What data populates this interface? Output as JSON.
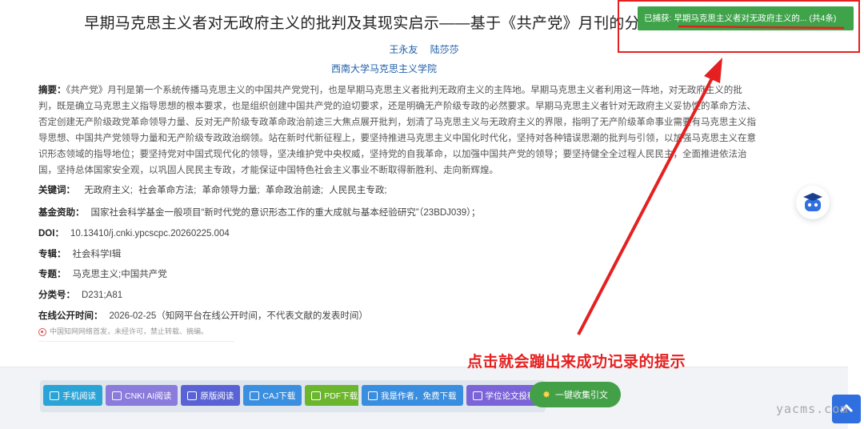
{
  "article": {
    "title": "早期马克思主义者对无政府主义的批判及其现实启示——基于《共产党》月刊的分",
    "authors": [
      "王永友",
      "陆莎莎"
    ],
    "institution": "西南大学马克思主义学院",
    "abstract_label": "摘要：",
    "abstract": "《共产党》月刊是第一个系统传播马克思主义的中国共产党党刊，也是早期马克思主义者批判无政府主义的主阵地。早期马克思主义者利用这一阵地，对无政府主义的批判，既是确立马克思主义指导思想的根本要求，也是组织创建中国共产党的迫切要求，还是明确无产阶级专政的必然要求。早期马克思主义者针对无政府主义妥协性的革命方法、否定创建无产阶级政党革命领导力量、反对无产阶级专政革命政治前途三大焦点展开批判，划清了马克思主义与无政府主义的界限，指明了无产阶级革命事业需要有马克思主义指导思想、中国共产党领导力量和无产阶级专政政治纲领。站在新时代新征程上，要坚持推进马克思主义中国化时代化，坚持对各种错误思潮的批判与引领，以加强马克思主义在意识形态领域的指导地位；要坚持党对中国式现代化的领导，坚决维护党中央权威，坚持党的自我革命，以加强中国共产党的领导；要坚持健全全过程人民民主，全面推进依法治国，坚持总体国家安全观，以巩固人民民主专政，才能保证中国特色社会主义事业不断取得新胜利、走向新辉煌。",
    "keywords_label": "关键词：",
    "keywords": [
      "无政府主义;",
      "社会革命方法;",
      "革命领导力量;",
      "革命政治前途;",
      "人民民主专政;"
    ],
    "fund_label": "基金资助：",
    "fund": "国家社会科学基金一般项目“新时代党的意识形态工作的重大成就与基本经验研究”（23BDJ039）；",
    "doi_label": "DOI：",
    "doi": "10.13410/j.cnki.ypcscpc.20260225.004",
    "series_label": "专辑：",
    "series": "社会科学Ⅰ辑",
    "topic_label": "专题：",
    "topic": "马克思主义;中国共产党",
    "class_label": "分类号：",
    "class": "D231;A81",
    "online_label": "在线公开时间：",
    "online": "2026-02-25（知网平台在线公开时间，不代表文献的发表时间）",
    "notice": "中国知网网络首发，未经许可，禁止转载、摘编。"
  },
  "toolbar": {
    "group1": [
      {
        "label": "手机阅读",
        "icon": "phone-icon",
        "color": "#2aa4d6"
      },
      {
        "label": "CNKI AI阅读",
        "icon": "ai-icon",
        "color": "#8a7bdc"
      },
      {
        "label": "原版阅读",
        "icon": "book-icon",
        "color": "#5a63d6"
      },
      {
        "label": "CAJ下载",
        "icon": "open-book-icon",
        "color": "#3b8fe0"
      },
      {
        "label": "PDF下载",
        "icon": "pdf-icon",
        "color": "#6cb62e"
      }
    ],
    "group2": [
      {
        "label": "我是作者，免费下载",
        "icon": "download-icon",
        "color": "#3a8ee0"
      },
      {
        "label": "学位论文投稿",
        "icon": "pen-icon",
        "color": "#7b64d8"
      }
    ],
    "collect_label": "一键收集引文"
  },
  "capture_toast": "已捕获: 早期马克思主义者对无政府主义的... (共4条)",
  "annotation": "点击就会蹦出来成功记录的提示",
  "watermark": "yacms.com",
  "colors": {
    "accent_red": "#e52020",
    "toast_green": "#3fa34a",
    "link_blue": "#1f5fa8"
  }
}
